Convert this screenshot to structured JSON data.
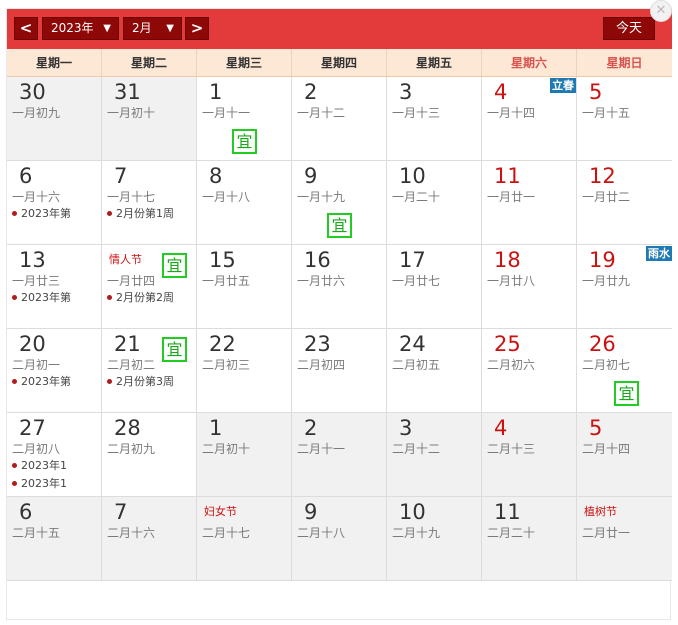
{
  "header": {
    "prev_label": "<",
    "next_label": ">",
    "year_label": "2023年",
    "month_label": "2月",
    "today_label": "今天"
  },
  "weekdays": [
    "星期一",
    "星期二",
    "星期三",
    "星期四",
    "星期五",
    "星期六",
    "星期日"
  ],
  "weeks": [
    [
      {
        "day": "30",
        "lunar": "一月初九",
        "other": true
      },
      {
        "day": "31",
        "lunar": "一月初十",
        "other": true
      },
      {
        "day": "1",
        "lunar": "一月十一",
        "yi": "宜"
      },
      {
        "day": "2",
        "lunar": "一月十二"
      },
      {
        "day": "3",
        "lunar": "一月十三"
      },
      {
        "day": "4",
        "lunar": "一月十四",
        "red": true,
        "term": "立春"
      },
      {
        "day": "5",
        "lunar": "一月十五",
        "red": true
      }
    ],
    [
      {
        "day": "6",
        "lunar": "一月十六",
        "events": [
          "2023年第"
        ]
      },
      {
        "day": "7",
        "lunar": "一月十七",
        "events": [
          "2月份第1周"
        ]
      },
      {
        "day": "8",
        "lunar": "一月十八"
      },
      {
        "day": "9",
        "lunar": "一月十九",
        "yi": "宜"
      },
      {
        "day": "10",
        "lunar": "一月二十"
      },
      {
        "day": "11",
        "lunar": "一月廿一",
        "red": true
      },
      {
        "day": "12",
        "lunar": "一月廿二",
        "red": true
      }
    ],
    [
      {
        "day": "13",
        "lunar": "一月廿三",
        "events": [
          "2023年第"
        ]
      },
      {
        "fest": "情人节",
        "lunar": "一月廿四",
        "yi": "宜",
        "events": [
          "2月份第2周"
        ]
      },
      {
        "day": "15",
        "lunar": "一月廿五"
      },
      {
        "day": "16",
        "lunar": "一月廿六"
      },
      {
        "day": "17",
        "lunar": "一月廿七"
      },
      {
        "day": "18",
        "lunar": "一月廿八",
        "red": true
      },
      {
        "day": "19",
        "lunar": "一月廿九",
        "red": true,
        "term": "雨水"
      }
    ],
    [
      {
        "day": "20",
        "lunar": "二月初一",
        "events": [
          "2023年第"
        ]
      },
      {
        "day": "21",
        "lunar": "二月初二",
        "yi": "宜",
        "events": [
          "2月份第3周"
        ]
      },
      {
        "day": "22",
        "lunar": "二月初三"
      },
      {
        "day": "23",
        "lunar": "二月初四"
      },
      {
        "day": "24",
        "lunar": "二月初五"
      },
      {
        "day": "25",
        "lunar": "二月初六",
        "red": true
      },
      {
        "day": "26",
        "lunar": "二月初七",
        "red": true,
        "yi": "宜"
      }
    ],
    [
      {
        "day": "27",
        "lunar": "二月初八",
        "events": [
          "2023年1",
          "2023年1"
        ]
      },
      {
        "day": "28",
        "lunar": "二月初九"
      },
      {
        "day": "1",
        "lunar": "二月初十",
        "other": true
      },
      {
        "day": "2",
        "lunar": "二月十一",
        "other": true
      },
      {
        "day": "3",
        "lunar": "二月十二",
        "other": true
      },
      {
        "day": "4",
        "lunar": "二月十三",
        "red": true,
        "other": true
      },
      {
        "day": "5",
        "lunar": "二月十四",
        "red": true,
        "other": true
      }
    ],
    [
      {
        "day": "6",
        "lunar": "二月十五",
        "other": true
      },
      {
        "day": "7",
        "lunar": "二月十六",
        "other": true
      },
      {
        "fest": "妇女节",
        "lunar": "二月十七",
        "other": true
      },
      {
        "day": "9",
        "lunar": "二月十八",
        "other": true
      },
      {
        "day": "10",
        "lunar": "二月十九",
        "other": true
      },
      {
        "day": "11",
        "lunar": "二月二十",
        "other": true
      },
      {
        "fest": "植树节",
        "lunar": "二月廿一",
        "other": true
      }
    ]
  ]
}
